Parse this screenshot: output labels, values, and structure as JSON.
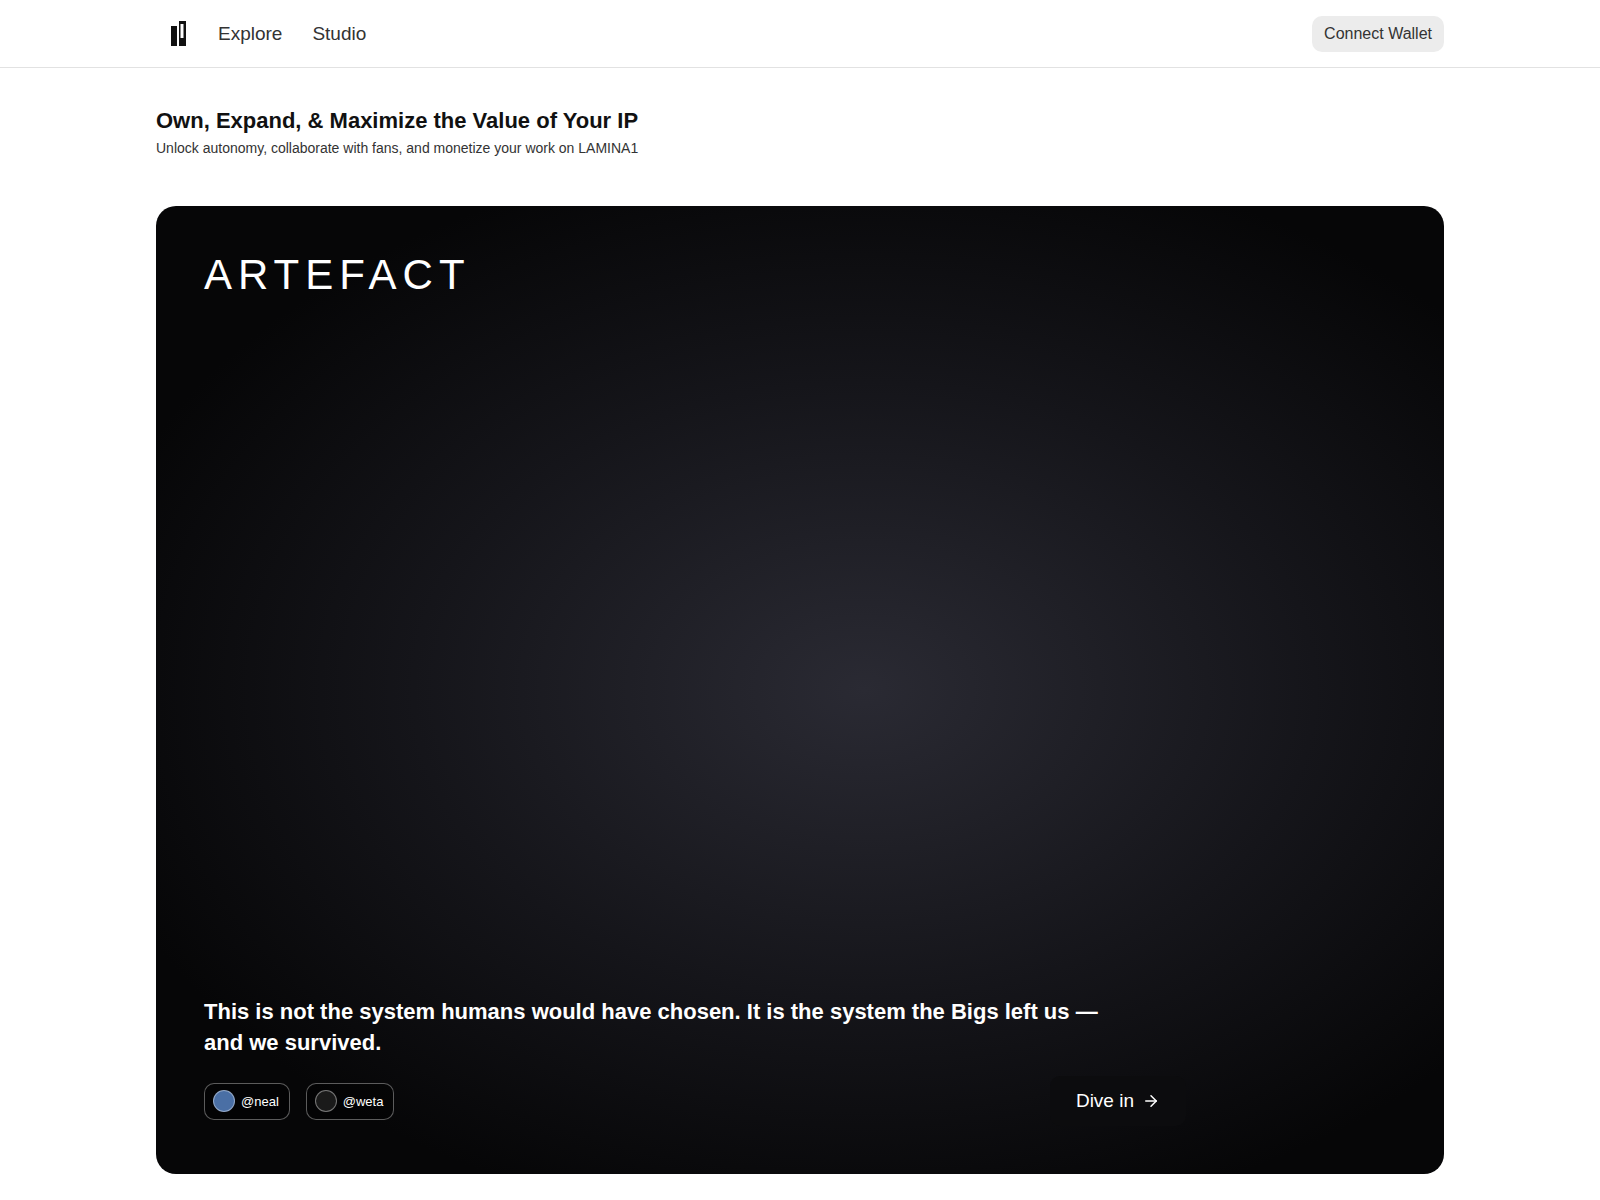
{
  "header": {
    "nav": [
      {
        "label": "Explore",
        "selected": false
      },
      {
        "label": "Studio",
        "selected": false
      }
    ],
    "connect_button": "Connect Wallet"
  },
  "intro": {
    "title": "Own, Expand, & Maximize the Value of Your IP",
    "subtitle": "Unlock autonomy, collaborate with fans, and monetize your work on LAMINA1"
  },
  "hero": {
    "brand": "ARTEFACT",
    "quote": "This is not the system humans would have chosen. It is the system the Bigs left us — and we survived.",
    "creators": [
      {
        "handle": "@neal",
        "color": "#4a6fa5"
      },
      {
        "handle": "@weta",
        "color": "#1a1a1a"
      }
    ],
    "cta": "Dive in"
  }
}
